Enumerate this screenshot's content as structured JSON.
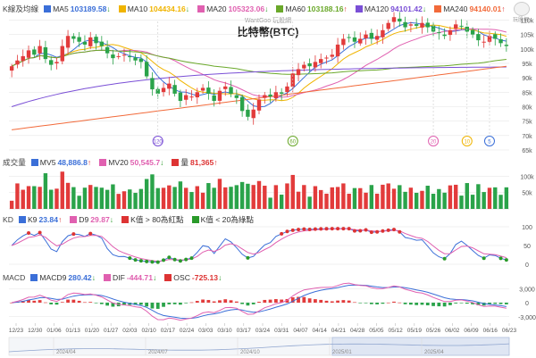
{
  "header": {
    "title": "比特幣(BTC)",
    "watermark": "WantGoo 玩股網",
    "logo_text": "玩股網"
  },
  "price_legend": {
    "label": "K線及均線",
    "items": [
      {
        "name": "MA5",
        "value": "103189.58",
        "arrow": "↓",
        "color": "#3b6fd8"
      },
      {
        "name": "MA10",
        "value": "104434.16",
        "arrow": "↓",
        "color": "#f0b400"
      },
      {
        "name": "MA20",
        "value": "105323.06",
        "arrow": "↓",
        "color": "#e060b0"
      },
      {
        "name": "MA60",
        "value": "103188.16",
        "arrow": "↑",
        "color": "#6aa82a"
      },
      {
        "name": "MA120",
        "value": "94101.42",
        "arrow": "↓",
        "color": "#7a4fd6"
      },
      {
        "name": "MA240",
        "value": "94140.01",
        "arrow": "↑",
        "color": "#f26a3a"
      }
    ]
  },
  "volume_legend": {
    "label": "成交量",
    "items": [
      {
        "name": "MV5",
        "value": "48,886.8",
        "arrow": "↑",
        "color": "#3b6fd8"
      },
      {
        "name": "MV20",
        "value": "50,545.7",
        "arrow": "↓",
        "color": "#e060b0"
      },
      {
        "name": "量",
        "value": "81,365",
        "arrow": "↑",
        "color": "#d33"
      }
    ]
  },
  "kd_legend": {
    "label": "KD",
    "items": [
      {
        "name": "K9",
        "value": "23.84",
        "arrow": "↑",
        "color": "#3b6fd8"
      },
      {
        "name": "D9",
        "value": "29.87",
        "arrow": "↓",
        "color": "#e060b0"
      },
      {
        "name": "K值 > 80為紅點",
        "value": "",
        "arrow": "",
        "color": "#d33"
      },
      {
        "name": "K值 < 20為綠點",
        "value": "",
        "arrow": "",
        "color": "#2a9a2a"
      }
    ]
  },
  "macd_legend": {
    "label": "MACD",
    "items": [
      {
        "name": "MACD9",
        "value": "280.42",
        "arrow": "↓",
        "color": "#3b6fd8"
      },
      {
        "name": "DIF",
        "value": "-444.71",
        "arrow": "↓",
        "color": "#e060b0"
      },
      {
        "name": "OSC",
        "value": "-725.13",
        "arrow": "↓",
        "color": "#d33"
      }
    ]
  },
  "colors": {
    "up": "#e23b3b",
    "down": "#2aa34a",
    "grid": "#e6e6e6"
  },
  "chart_data": {
    "type": "candlestick",
    "y_ticks": [
      "110k",
      "105k",
      "100k",
      "95k",
      "90k",
      "85k",
      "80k",
      "75k",
      "70k",
      "65k"
    ],
    "ylim": [
      65000,
      112000
    ],
    "close": [
      94000,
      96000,
      97500,
      99500,
      98000,
      101000,
      96500,
      94500,
      95500,
      101000,
      104500,
      103500,
      102500,
      101500,
      104000,
      102000,
      101000,
      98500,
      96800,
      97500,
      98000,
      97200,
      96000,
      95500,
      90500,
      86000,
      84500,
      86500,
      88000,
      84500,
      82000,
      84000,
      83500,
      85000,
      86500,
      84500,
      82000,
      85500,
      87000,
      84500,
      83000,
      78500,
      76500,
      79000,
      82500,
      84000,
      83500,
      85000,
      84500,
      87000,
      91500,
      93000,
      94500,
      94000,
      95500,
      96500,
      97000,
      98000,
      101500,
      103500,
      104000,
      102500,
      103500,
      105000,
      103500,
      104500,
      106500,
      109000,
      111000,
      109500,
      107500,
      108500,
      108000,
      109000,
      107500,
      106000,
      105500,
      104500,
      106500,
      108500,
      108000,
      106000,
      105000,
      103000,
      102500,
      104500,
      103500,
      102000,
      101000
    ],
    "ma_markers": [
      {
        "label": "120",
        "color": "#7a4fd6",
        "index": 26
      },
      {
        "label": "60",
        "color": "#6aa82a",
        "index": 50
      },
      {
        "label": "20",
        "color": "#e060b0",
        "index": 75
      },
      {
        "label": "10",
        "color": "#f0b400",
        "index": 81
      },
      {
        "label": "5",
        "color": "#3b6fd8",
        "index": 85
      }
    ],
    "volume_ticks": [
      "100k",
      "50k"
    ],
    "kd_ticks": [
      "100",
      "50",
      "0"
    ],
    "macd_ticks": [
      "3,000",
      "0",
      "-3,000"
    ],
    "x_labels": [
      "12/23",
      "12/30",
      "01/06",
      "01/13",
      "01/20",
      "01/27",
      "02/03",
      "02/10",
      "02/17",
      "02/24",
      "03/03",
      "03/10",
      "03/17",
      "03/24",
      "03/31",
      "04/07",
      "04/14",
      "04/21",
      "04/28",
      "05/05",
      "05/12",
      "05/19",
      "05/26",
      "06/02",
      "06/09",
      "06/16",
      "06/23"
    ],
    "nav_labels": [
      "2024/04",
      "2024/07",
      "2024/10",
      "2025/01",
      "2025/04"
    ]
  }
}
